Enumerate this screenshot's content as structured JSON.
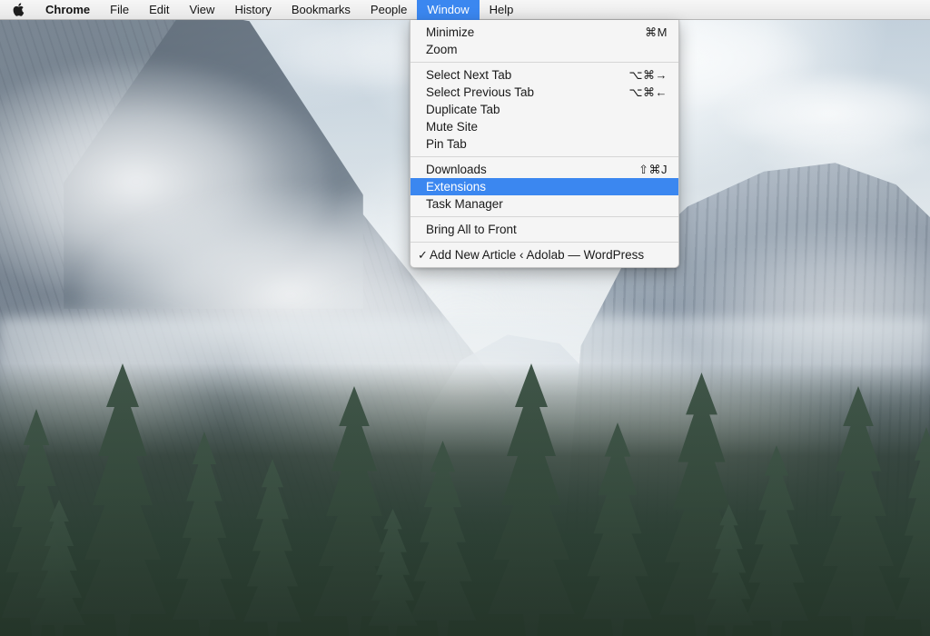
{
  "menubar": {
    "apple_icon": "apple-logo-icon",
    "items": [
      {
        "label": "Chrome",
        "bold": true,
        "active": false
      },
      {
        "label": "File",
        "bold": false,
        "active": false
      },
      {
        "label": "Edit",
        "bold": false,
        "active": false
      },
      {
        "label": "View",
        "bold": false,
        "active": false
      },
      {
        "label": "History",
        "bold": false,
        "active": false
      },
      {
        "label": "Bookmarks",
        "bold": false,
        "active": false
      },
      {
        "label": "People",
        "bold": false,
        "active": false
      },
      {
        "label": "Window",
        "bold": false,
        "active": true
      },
      {
        "label": "Help",
        "bold": false,
        "active": false
      }
    ],
    "active_menu": "Window",
    "highlight_color": "#3b87f0"
  },
  "window_menu": {
    "title": "Window",
    "highlight_color": "#3b87f0",
    "groups": [
      {
        "items": [
          {
            "label": "Minimize",
            "shortcut": "⌘M",
            "checked": false,
            "highlighted": false
          },
          {
            "label": "Zoom",
            "shortcut": "",
            "checked": false,
            "highlighted": false
          }
        ]
      },
      {
        "items": [
          {
            "label": "Select Next Tab",
            "shortcut": "⌥⌘→",
            "checked": false,
            "highlighted": false
          },
          {
            "label": "Select Previous Tab",
            "shortcut": "⌥⌘←",
            "checked": false,
            "highlighted": false
          },
          {
            "label": "Duplicate Tab",
            "shortcut": "",
            "checked": false,
            "highlighted": false
          },
          {
            "label": "Mute Site",
            "shortcut": "",
            "checked": false,
            "highlighted": false
          },
          {
            "label": "Pin Tab",
            "shortcut": "",
            "checked": false,
            "highlighted": false
          }
        ]
      },
      {
        "items": [
          {
            "label": "Downloads",
            "shortcut": "⇧⌘J",
            "checked": false,
            "highlighted": false
          },
          {
            "label": "Extensions",
            "shortcut": "",
            "checked": false,
            "highlighted": true
          },
          {
            "label": "Task Manager",
            "shortcut": "",
            "checked": false,
            "highlighted": false
          }
        ]
      },
      {
        "items": [
          {
            "label": "Bring All to Front",
            "shortcut": "",
            "checked": false,
            "highlighted": false
          }
        ]
      },
      {
        "items": [
          {
            "label": "Add New Article ‹ Adolab — WordPress",
            "shortcut": "",
            "checked": true,
            "highlighted": false
          }
        ]
      }
    ],
    "check_glyph": "✓"
  },
  "desktop": {
    "wallpaper_name": "yosemite-half-dome-mist",
    "sky_color": "#dbe4ea",
    "rock_color": "#8d99a6",
    "forest_color": "#2b3f33"
  }
}
